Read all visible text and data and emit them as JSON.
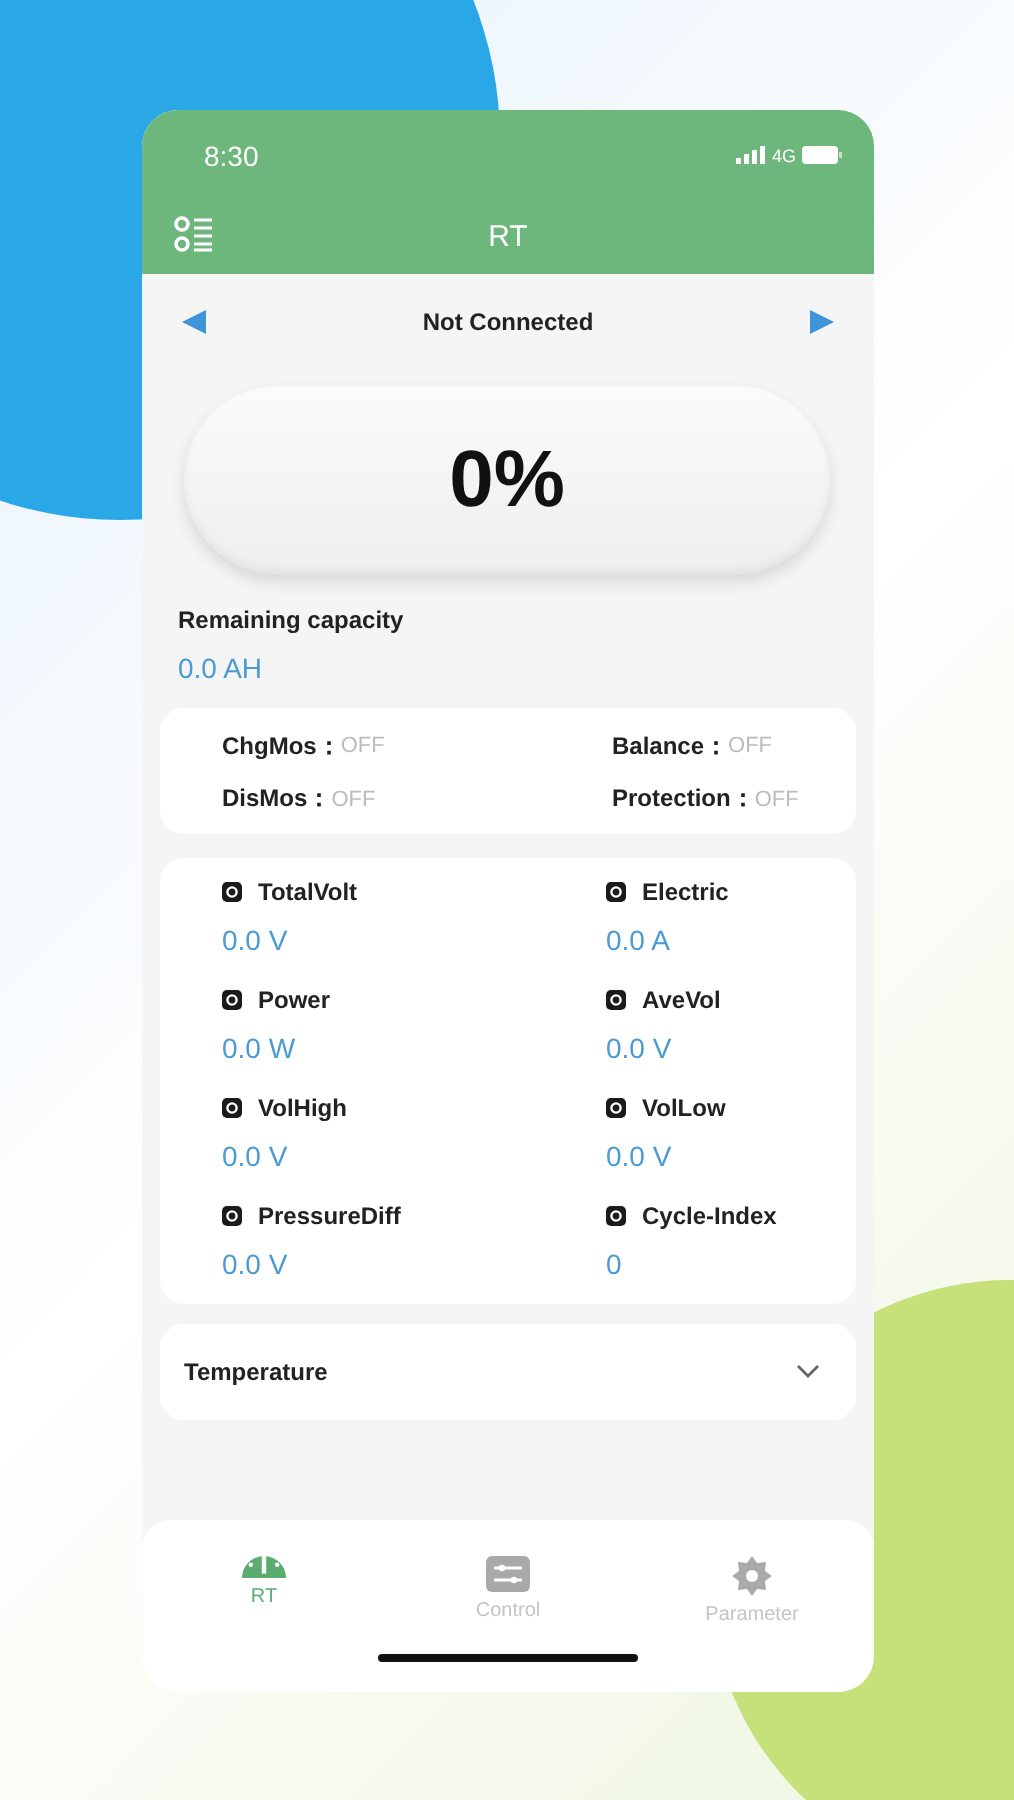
{
  "status_bar": {
    "time": "8:30",
    "network": "4G"
  },
  "header": {
    "title": "RT"
  },
  "device": {
    "name": "Not Connected"
  },
  "gauge": {
    "percent": "0%"
  },
  "capacity": {
    "label": "Remaining capacity",
    "value": "0.0 AH"
  },
  "switches": [
    {
      "label": "ChgMos：",
      "value": "OFF"
    },
    {
      "label": "Balance：",
      "value": "OFF"
    },
    {
      "label": "DisMos：",
      "value": "OFF"
    },
    {
      "label": "Protection：",
      "value": "OFF"
    }
  ],
  "metrics": [
    {
      "label": "TotalVolt",
      "value": "0.0 V"
    },
    {
      "label": "Electric",
      "value": "0.0 A"
    },
    {
      "label": "Power",
      "value": "0.0 W"
    },
    {
      "label": "AveVol",
      "value": "0.0 V"
    },
    {
      "label": "VolHigh",
      "value": "0.0 V"
    },
    {
      "label": "VolLow",
      "value": "0.0 V"
    },
    {
      "label": "PressureDiff",
      "value": "0.0 V"
    },
    {
      "label": "Cycle-Index",
      "value": "0"
    }
  ],
  "temperature": {
    "label": "Temperature",
    "expanded": false
  },
  "tabs": [
    {
      "kind": "gauge",
      "label": "RT",
      "selected": true
    },
    {
      "kind": "sliders",
      "label": "Control",
      "selected": false
    },
    {
      "kind": "gear",
      "label": "Parameter",
      "selected": false
    }
  ]
}
